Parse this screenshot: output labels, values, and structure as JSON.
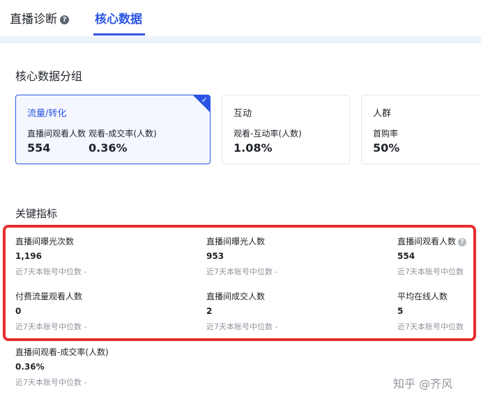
{
  "tabs": {
    "diagnosis": "直播诊断",
    "core": "核心数据"
  },
  "group_section": {
    "title": "核心数据分组",
    "cards": [
      {
        "title": "流量/转化",
        "metrics": [
          {
            "label": "直播间观看人数",
            "value": "554"
          },
          {
            "label": "观看-成交率(人数)",
            "value": "0.36%"
          }
        ]
      },
      {
        "title": "互动",
        "metrics": [
          {
            "label": "观看-互动率(人数)",
            "value": "1.08%"
          }
        ]
      },
      {
        "title": "人群",
        "metrics": [
          {
            "label": "首购率",
            "value": "50%"
          }
        ]
      }
    ]
  },
  "key_section": {
    "title": "关键指标",
    "items": [
      {
        "label": "直播间曝光次数",
        "value": "1,196",
        "sub": "近7天本账号中位数 -"
      },
      {
        "label": "直播间曝光人数",
        "value": "953",
        "sub": "近7天本账号中位数 -"
      },
      {
        "label": "直播间观看人数",
        "value": "554",
        "sub": "近7天本账号中位数"
      },
      {
        "label": "付费流量观看人数",
        "value": "0",
        "sub": "近7天本账号中位数 -"
      },
      {
        "label": "直播间成交人数",
        "value": "2",
        "sub": "近7天本账号中位数 -"
      },
      {
        "label": "平均在线人数",
        "value": "5",
        "sub": "近7天本账号中位数"
      },
      {
        "label": "直播间观看-成交率(人数)",
        "value": "0.36%",
        "sub": "近7天本账号中位数 -"
      }
    ]
  },
  "watermark": "知乎 @齐风",
  "colors": {
    "accent": "#2a55e5",
    "highlight_border": "#e52e2e"
  }
}
